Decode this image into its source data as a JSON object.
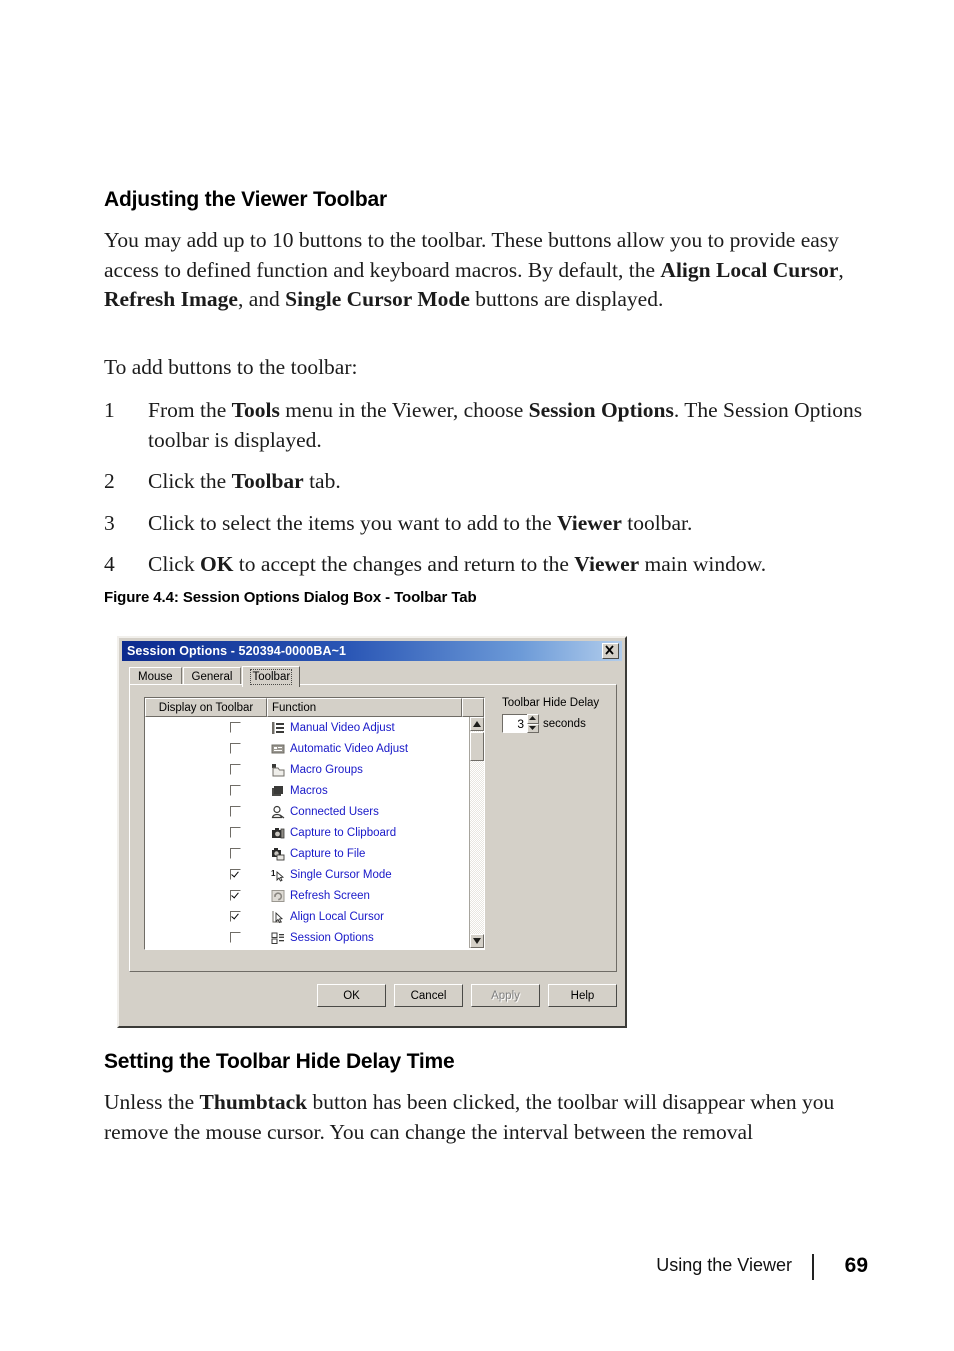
{
  "document": {
    "section1": {
      "heading": "Adjusting the Viewer Toolbar",
      "para1_part1": "You may add up to 10 buttons to the toolbar. These buttons allow you to provide easy access to defined function and keyboard macros. By default, the ",
      "para1_bold1": "Align Local Cursor",
      "para1_part2": ", ",
      "para1_bold2": "Refresh Image",
      "para1_part3": ", and ",
      "para1_bold3": "Single Cursor Mode",
      "para1_part4": " buttons are displayed.",
      "lead_in": "To add buttons to the toolbar:",
      "steps": [
        {
          "num": "1",
          "t1": "From the ",
          "b1": "Tools",
          "t2": " menu in the Viewer, choose ",
          "b2": "Session Options",
          "t3": ". The Session Options toolbar is displayed."
        },
        {
          "num": "2",
          "t1": "Click the ",
          "b1": "Toolbar",
          "t2": " tab.",
          "b2": "",
          "t3": ""
        },
        {
          "num": "3",
          "t1": "Click to select the items you want to add to the ",
          "b1": "Viewer",
          "t2": " toolbar.",
          "b2": "",
          "t3": ""
        },
        {
          "num": "4",
          "t1": "Click ",
          "b1": "OK",
          "t2": " to accept the changes and return to the ",
          "b2": "Viewer",
          "t3": " main window."
        }
      ]
    },
    "figure": {
      "caption": "Figure 4.4: Session Options Dialog Box - Toolbar Tab"
    },
    "section2": {
      "heading": "Setting the Toolbar Hide Delay Time",
      "para1_part1": "Unless the ",
      "para1_bold1": "Thumbtack",
      "para1_part2": " button has been clicked, the toolbar will disappear when you remove the mouse cursor. You can change the interval between the removal"
    },
    "footer": {
      "label": "Using the Viewer",
      "page": "69"
    }
  },
  "dialog": {
    "title": "Session Options - 520394-0000BA~1",
    "close_icon": "close-icon",
    "tabs": [
      {
        "label": "Mouse",
        "active": false
      },
      {
        "label": "General",
        "active": false
      },
      {
        "label": "Toolbar",
        "active": true
      }
    ],
    "list": {
      "columns": [
        "Display on Toolbar",
        "Function"
      ],
      "rows": [
        {
          "checked": false,
          "icon": "manual-video-adjust-icon",
          "label": "Manual Video Adjust"
        },
        {
          "checked": false,
          "icon": "automatic-video-adjust-icon",
          "label": "Automatic Video Adjust"
        },
        {
          "checked": false,
          "icon": "macro-groups-icon",
          "label": "Macro Groups"
        },
        {
          "checked": false,
          "icon": "macros-icon",
          "label": "Macros"
        },
        {
          "checked": false,
          "icon": "connected-users-icon",
          "label": "Connected Users"
        },
        {
          "checked": false,
          "icon": "capture-to-clipboard-icon",
          "label": "Capture to Clipboard"
        },
        {
          "checked": false,
          "icon": "capture-to-file-icon",
          "label": "Capture to File"
        },
        {
          "checked": true,
          "icon": "single-cursor-mode-icon",
          "label": "Single Cursor Mode"
        },
        {
          "checked": true,
          "icon": "refresh-screen-icon",
          "label": "Refresh Screen"
        },
        {
          "checked": true,
          "icon": "align-local-cursor-icon",
          "label": "Align Local Cursor"
        },
        {
          "checked": false,
          "icon": "session-options-icon",
          "label": "Session Options"
        }
      ]
    },
    "hide_delay": {
      "label": "Toolbar Hide Delay",
      "value": "3",
      "units": "seconds"
    },
    "buttons": [
      {
        "label": "OK",
        "disabled": false
      },
      {
        "label": "Cancel",
        "disabled": false
      },
      {
        "label": "Apply",
        "disabled": true
      },
      {
        "label": "Help",
        "disabled": false
      }
    ],
    "colors": {
      "face": "#d4d0c8",
      "title_dark": "#0b2a8e",
      "title_light": "#b2cdec",
      "link_text": "#1818c8"
    }
  }
}
